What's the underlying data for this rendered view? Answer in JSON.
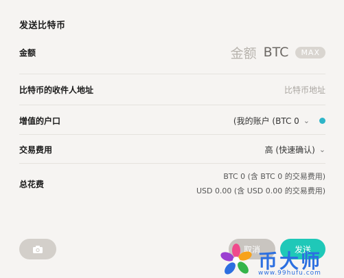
{
  "title": "发送比特币",
  "amount": {
    "label": "金额",
    "placeholder": "金额",
    "unit": "BTC",
    "max_label": "MAX"
  },
  "recipient": {
    "label": "比特币的收件人地址",
    "placeholder": "比特币地址"
  },
  "funding_account": {
    "label": "增值的户口",
    "value": "(我的账户 (BTC 0",
    "status_color": "#2eb5c8"
  },
  "fee": {
    "label": "交易费用",
    "value": "高 (快速确认)"
  },
  "total": {
    "label": "总花费",
    "btc_line": "BTC 0 (含 BTC 0 的交易费用)",
    "usd_line": "USD 0.00 (含 USD 0.00 的交易费用)"
  },
  "buttons": {
    "cancel": "取消",
    "send": "发送",
    "camera_icon": "camera-icon"
  },
  "watermark": {
    "text": "币大师",
    "url": "www.99hufu.com"
  },
  "colors": {
    "accent": "#1fc8b8",
    "background": "#f6f4f2"
  }
}
